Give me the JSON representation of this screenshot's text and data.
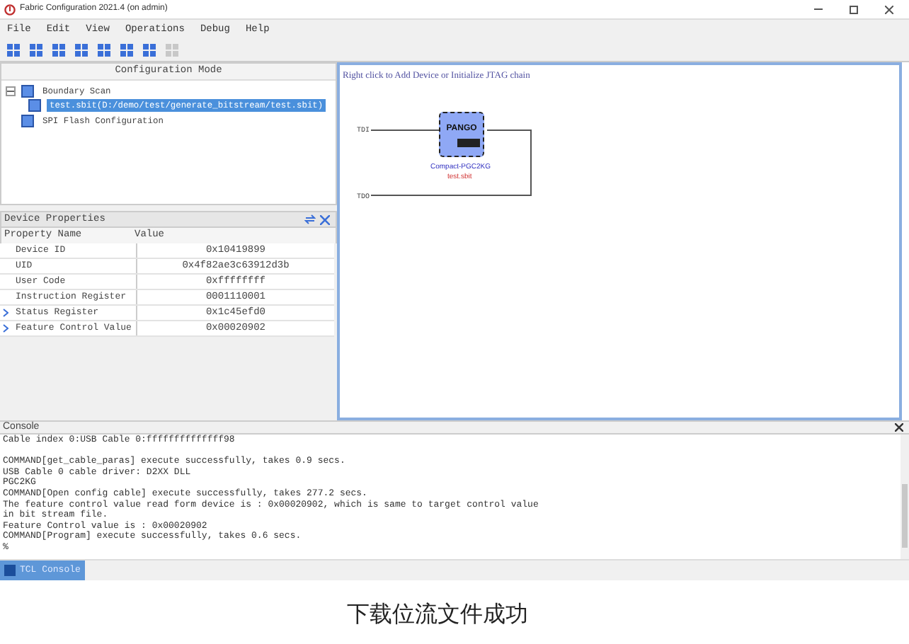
{
  "window": {
    "title": "Fabric Configuration 2021.4 (on admin)"
  },
  "menu": [
    "File",
    "Edit",
    "View",
    "Operations",
    "Debug",
    "Help"
  ],
  "toolbar": [
    {
      "disabled": false
    },
    {
      "disabled": false
    },
    {
      "disabled": false
    },
    {
      "disabled": false
    },
    {
      "disabled": false
    },
    {
      "disabled": false
    },
    {
      "disabled": false
    },
    {
      "disabled": true
    }
  ],
  "config_mode": {
    "title": "Configuration Mode",
    "tree": [
      {
        "label": "Boundary Scan",
        "expanded": true,
        "selected": false,
        "children": [
          {
            "label": "test.sbit(D:/demo/test/generate_bitstream/test.sbit)",
            "selected": true
          }
        ]
      },
      {
        "label": "SPI Flash Configuration",
        "selected": false
      }
    ]
  },
  "device_properties": {
    "title": "Device Properties",
    "columns": [
      "Property Name",
      "Value"
    ],
    "rows": [
      {
        "name": "Device ID",
        "value": "0x10419899",
        "expandable": false
      },
      {
        "name": "UID",
        "value": "0x4f82ae3c63912d3b",
        "expandable": false
      },
      {
        "name": "User Code",
        "value": "0xffffffff",
        "expandable": false
      },
      {
        "name": "Instruction Register",
        "value": "0001110001",
        "expandable": false
      },
      {
        "name": "Status Register",
        "value": "0x1c45efd0",
        "expandable": true
      },
      {
        "name": "Feature Control Value",
        "value": "0x00020902",
        "expandable": true
      }
    ]
  },
  "canvas": {
    "hint": "Right click to Add Device or Initialize JTAG chain",
    "tdi": "TDI",
    "tdo": "TDO",
    "device": {
      "brand": "PANGO",
      "name": "Compact-PGC2KG",
      "file": "test.sbit"
    }
  },
  "console": {
    "title": "Console",
    "lines": [
      "Cable index 0:USB Cable 0:ffffffffffffff98",
      "COMMAND[get_cable_paras] execute successfully, takes 0.9 secs.",
      "USB Cable 0 cable driver: D2XX DLL",
      "PGC2KG",
      "COMMAND[Open config cable] execute successfully, takes 277.2 secs.",
      "The feature control value read form device is : 0x00020902, which is same to target control value",
      "in bit stream file.",
      "Feature Control value is : 0x00020902",
      "COMMAND[Program] execute successfully, takes 0.6 secs.",
      "%"
    ],
    "tabs": [
      {
        "label": "TCL Console",
        "selected": true
      }
    ]
  },
  "caption": "下载位流文件成功"
}
